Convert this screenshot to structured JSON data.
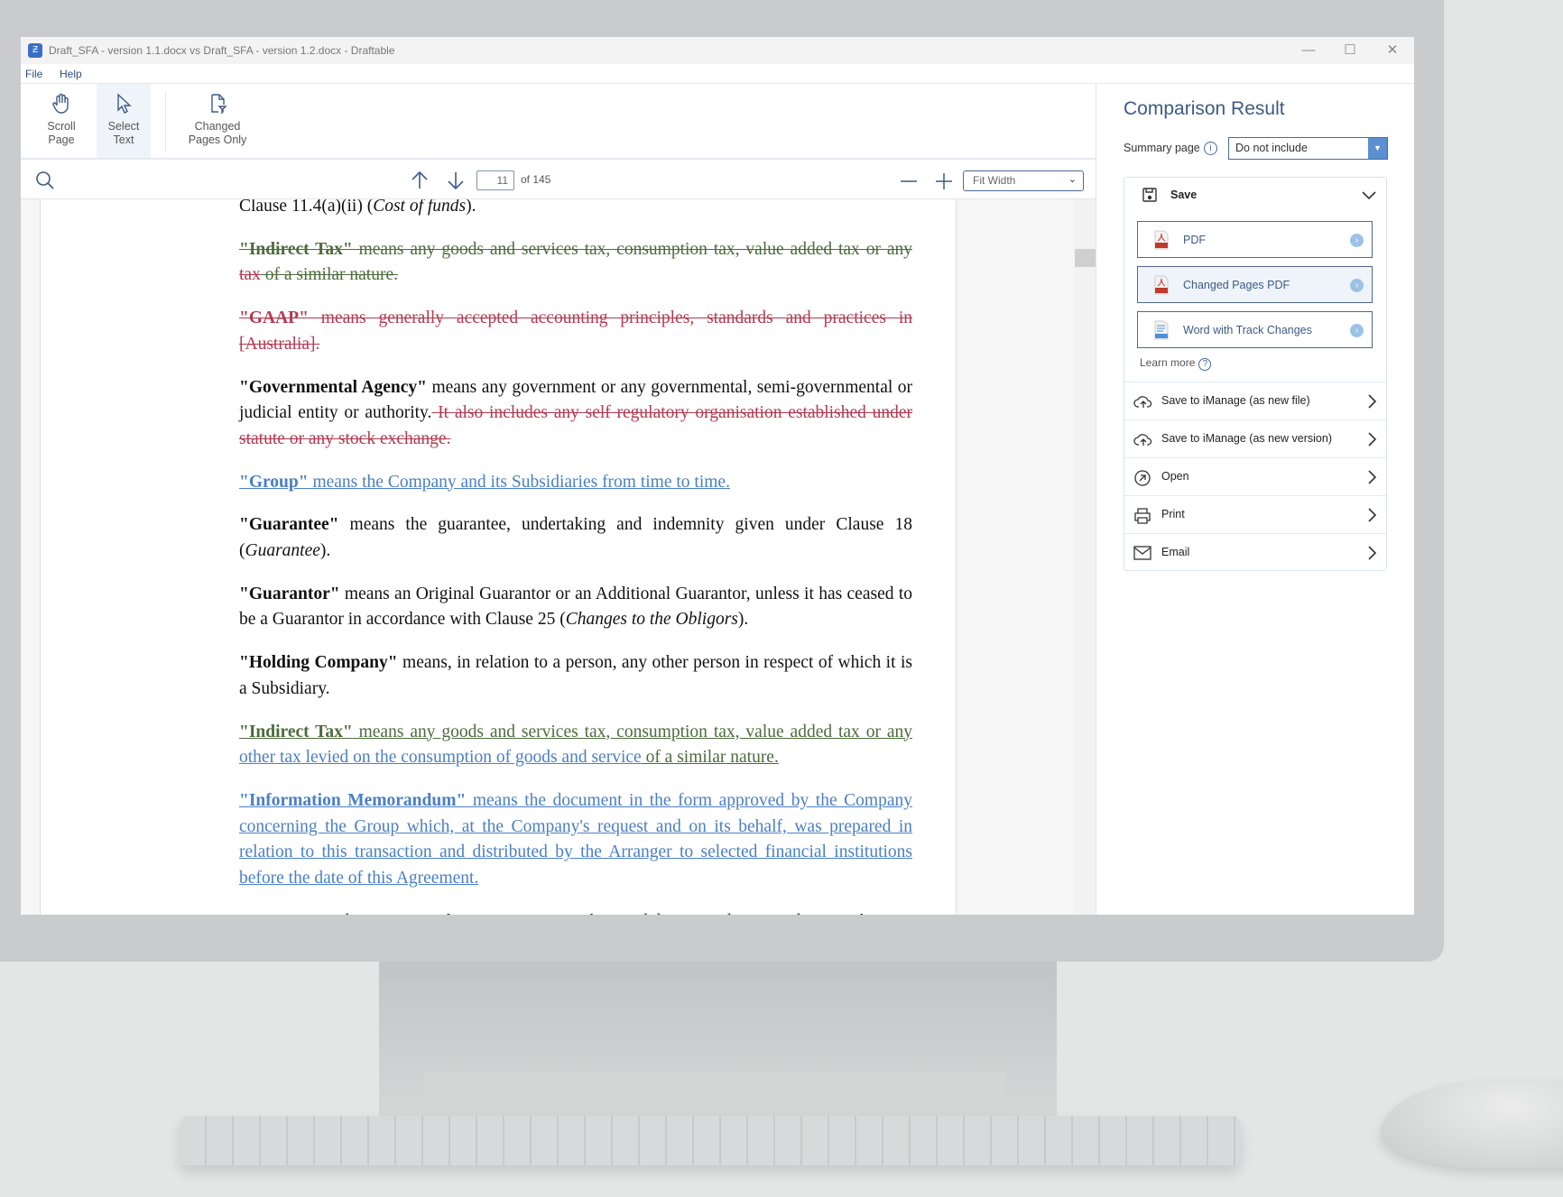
{
  "window": {
    "title": "Draft_SFA - version 1.1.docx vs Draft_SFA - version 1.2.docx - Draftable",
    "app_icon": "Ƶ"
  },
  "menu": [
    "File",
    "Help"
  ],
  "toolbar": {
    "scroll_page": [
      "Scroll",
      "Page"
    ],
    "select_text": [
      "Select",
      "Text"
    ],
    "changed_pages_only": [
      "Changed",
      "Pages Only"
    ]
  },
  "nav": {
    "current_page": "11",
    "total_pages": "of 145",
    "zoom_mode": "Fit Width"
  },
  "document": {
    "paragraphs": [
      [
        {
          "t": "Clause 11.4(a)(ii) (",
          "k": "plain"
        },
        {
          "t": "Cost of funds",
          "k": "plain",
          "i": true
        },
        {
          "t": ").",
          "k": "plain"
        }
      ],
      [
        {
          "t": "\"Indirect Tax\"",
          "k": "movdel",
          "b": true
        },
        {
          "t": " means any goods and services tax, consumption tax, value added tax or any ",
          "k": "movdel"
        },
        {
          "t": "tax",
          "k": "del"
        },
        {
          "t": " of a similar nature.",
          "k": "movdel"
        }
      ],
      [
        {
          "t": "\"GAAP\"",
          "k": "del",
          "b": true
        },
        {
          "t": " means generally accepted accounting principles, standards and practices in [Australia].",
          "k": "del"
        }
      ],
      [
        {
          "t": "\"Governmental Agency\"",
          "k": "plain",
          "b": true
        },
        {
          "t": " means any government or any governmental, semi-governmental or judicial entity or authority.",
          "k": "plain"
        },
        {
          "t": "  It also includes any self regulatory organisation established under statute or any stock exchange.",
          "k": "del"
        }
      ],
      [
        {
          "t": "\"Group\"",
          "k": "ins",
          "b": true
        },
        {
          "t": " means the Company and its Subsidiaries from time to time.",
          "k": "ins"
        }
      ],
      [
        {
          "t": "\"Guarantee\"",
          "k": "plain",
          "b": true
        },
        {
          "t": " means the guarantee, undertaking and indemnity given under Clause 18 (",
          "k": "plain"
        },
        {
          "t": "Guarantee",
          "k": "plain",
          "i": true
        },
        {
          "t": ").",
          "k": "plain"
        }
      ],
      [
        {
          "t": "\"Guarantor\"",
          "k": "plain",
          "b": true
        },
        {
          "t": " means an Original Guarantor or an Additional Guarantor, unless it has ceased to be a Guarantor in accordance with Clause 25 (",
          "k": "plain"
        },
        {
          "t": "Changes to the Obligors",
          "k": "plain",
          "i": true
        },
        {
          "t": ").",
          "k": "plain"
        }
      ],
      [
        {
          "t": "\"Holding Company\"",
          "k": "plain",
          "b": true
        },
        {
          "t": " means, in relation to a person, any other person in respect of which it is a Subsidiary.",
          "k": "plain"
        }
      ],
      [
        {
          "t": "\"Indirect Tax\"",
          "k": "movins",
          "b": true
        },
        {
          "t": " means any goods and services tax, consumption tax, value added tax or any ",
          "k": "movins"
        },
        {
          "t": "other tax levied on the consumption of goods and service",
          "k": "ins"
        },
        {
          "t": " of a similar nature.",
          "k": "movins"
        }
      ],
      [
        {
          "t": "\"Information Memorandum\"",
          "k": "ins",
          "b": true
        },
        {
          "t": " means the document in the form approved by the Company concerning the Group which, at the Company's request and on its behalf, was prepared in relation to this transaction and distributed by the Arranger to selected financial institutions before the date of this Agreement.",
          "k": "ins"
        }
      ],
      [
        {
          "t": "\"Interest Period\" means, in relation to a Loan, each period determined in accordance with",
          "k": "plain"
        }
      ]
    ]
  },
  "panel": {
    "title": "Comparison Result",
    "summary_label": "Summary page",
    "summary_value": "Do not include",
    "save_label": "Save",
    "exports": [
      {
        "label": "PDF",
        "icon": "pdf-icon"
      },
      {
        "label": "Changed Pages PDF",
        "icon": "pdf-icon"
      },
      {
        "label": "Word with Track Changes",
        "icon": "docx-icon"
      }
    ],
    "learn_more": "Learn more",
    "actions": [
      {
        "label": "Save to iManage (as new file)",
        "icon": "cloud-upload-icon"
      },
      {
        "label": "Save to iManage (as new version)",
        "icon": "cloud-upload-icon"
      },
      {
        "label": "Open",
        "icon": "open-external-icon"
      },
      {
        "label": "Print",
        "icon": "printer-icon"
      },
      {
        "label": "Email",
        "icon": "envelope-icon"
      }
    ]
  },
  "colors": {
    "deleted": "#b23a52",
    "inserted": "#4a7fc4",
    "moved": "#4c6b3c",
    "accent": "#3d5a85"
  }
}
